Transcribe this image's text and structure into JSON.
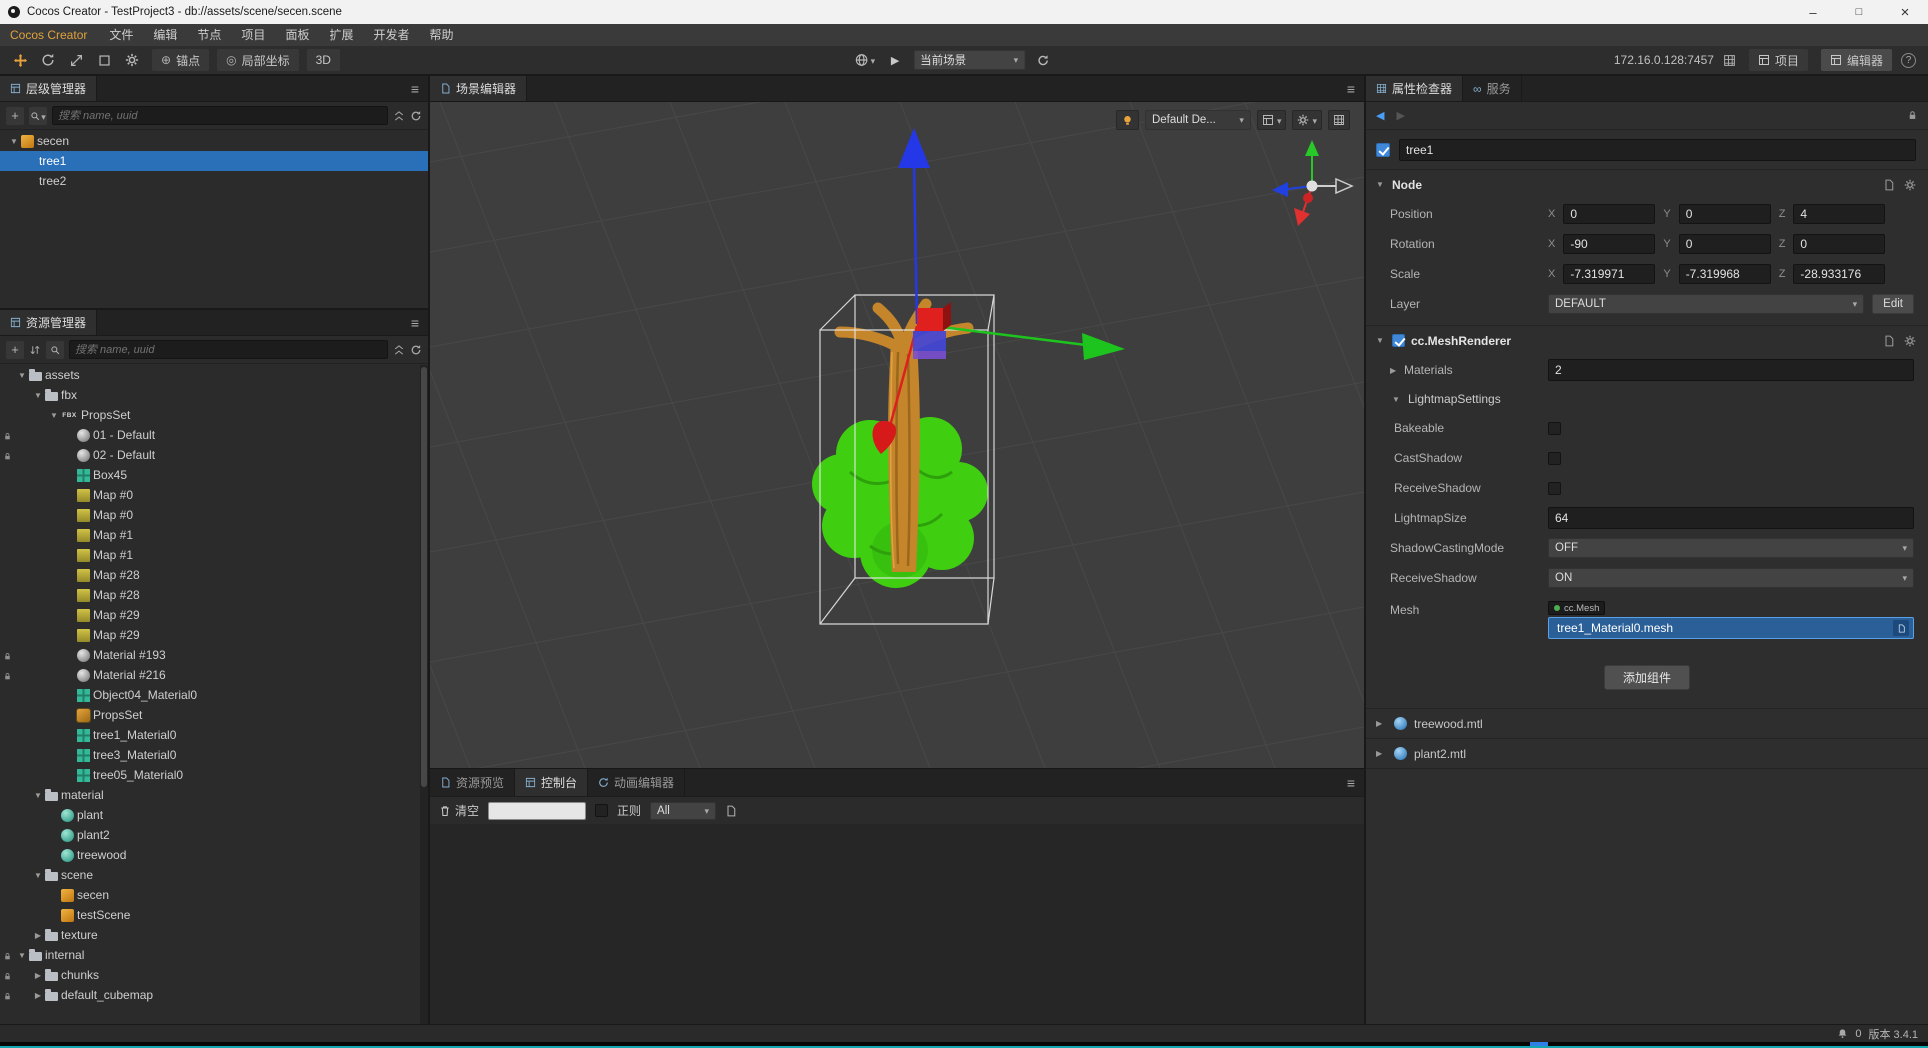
{
  "window": {
    "title": "Cocos Creator - TestProject3 - db://assets/scene/secen.scene"
  },
  "menubar": {
    "brand": "Cocos Creator",
    "items": [
      "文件",
      "编辑",
      "节点",
      "项目",
      "面板",
      "扩展",
      "开发者",
      "帮助"
    ]
  },
  "toolbar": {
    "anchor": "锚点",
    "local_coords": "局部坐标",
    "mode_3d": "3D",
    "scene_select": "当前场景",
    "address": "172.16.0.128:7457",
    "project": "项目",
    "editor": "编辑器"
  },
  "hierarchy": {
    "title": "层级管理器",
    "search_placeholder": "搜索 name, uuid",
    "nodes": [
      {
        "t": "secen",
        "d": 0,
        "i": "scene",
        "a": "open",
        "sel": 0
      },
      {
        "t": "tree1",
        "d": 1,
        "i": "none",
        "a": "none",
        "sel": 1
      },
      {
        "t": "tree2",
        "d": 1,
        "i": "none",
        "a": "none",
        "sel": 0
      }
    ]
  },
  "assets": {
    "title": "资源管理器",
    "search_placeholder": "搜索 name, uuid",
    "fbx_badge": "FBX",
    "items": [
      {
        "t": "assets",
        "i": "folder",
        "d": 0,
        "a": "open",
        "l": 0
      },
      {
        "t": "fbx",
        "i": "folder",
        "d": 1,
        "a": "open",
        "l": 0
      },
      {
        "t": "PropsSet",
        "i": "fbx",
        "d": 2,
        "a": "open",
        "l": 0
      },
      {
        "t": "01 - Default",
        "i": "matgray",
        "d": 3,
        "a": "none",
        "l": 1
      },
      {
        "t": "02 - Default",
        "i": "matgray",
        "d": 3,
        "a": "none",
        "l": 1
      },
      {
        "t": "Box45",
        "i": "mesh",
        "d": 3,
        "a": "none",
        "l": 0
      },
      {
        "t": "Map #0",
        "i": "image",
        "d": 3,
        "a": "none",
        "l": 0
      },
      {
        "t": "Map #0",
        "i": "image",
        "d": 3,
        "a": "none",
        "l": 0
      },
      {
        "t": "Map #1",
        "i": "image",
        "d": 3,
        "a": "none",
        "l": 0
      },
      {
        "t": "Map #1",
        "i": "image",
        "d": 3,
        "a": "none",
        "l": 0
      },
      {
        "t": "Map #28",
        "i": "image",
        "d": 3,
        "a": "none",
        "l": 0
      },
      {
        "t": "Map #28",
        "i": "image",
        "d": 3,
        "a": "none",
        "l": 0
      },
      {
        "t": "Map #29",
        "i": "image",
        "d": 3,
        "a": "none",
        "l": 0
      },
      {
        "t": "Map #29",
        "i": "image",
        "d": 3,
        "a": "none",
        "l": 0
      },
      {
        "t": "Material #193",
        "i": "matgray",
        "d": 3,
        "a": "none",
        "l": 1
      },
      {
        "t": "Material #216",
        "i": "matgray",
        "d": 3,
        "a": "none",
        "l": 1
      },
      {
        "t": "Object04_Material0",
        "i": "mesh",
        "d": 3,
        "a": "none",
        "l": 0
      },
      {
        "t": "PropsSet",
        "i": "prefab",
        "d": 3,
        "a": "none",
        "l": 0
      },
      {
        "t": "tree1_Material0",
        "i": "mesh",
        "d": 3,
        "a": "none",
        "l": 0
      },
      {
        "t": "tree3_Material0",
        "i": "mesh",
        "d": 3,
        "a": "none",
        "l": 0
      },
      {
        "t": "tree05_Material0",
        "i": "mesh",
        "d": 3,
        "a": "none",
        "l": 0
      },
      {
        "t": "material",
        "i": "folder",
        "d": 1,
        "a": "open",
        "l": 0
      },
      {
        "t": "plant",
        "i": "matball",
        "d": 2,
        "a": "none",
        "l": 0
      },
      {
        "t": "plant2",
        "i": "matball",
        "d": 2,
        "a": "none",
        "l": 0
      },
      {
        "t": "treewood",
        "i": "matball",
        "d": 2,
        "a": "none",
        "l": 0
      },
      {
        "t": "scene",
        "i": "folder",
        "d": 1,
        "a": "open",
        "l": 0
      },
      {
        "t": "secen",
        "i": "scene",
        "d": 2,
        "a": "none",
        "l": 0
      },
      {
        "t": "testScene",
        "i": "scene",
        "d": 2,
        "a": "none",
        "l": 0
      },
      {
        "t": "texture",
        "i": "folder",
        "d": 1,
        "a": "closed",
        "l": 0
      },
      {
        "t": "internal",
        "i": "folder",
        "d": 0,
        "a": "open",
        "l": 1
      },
      {
        "t": "chunks",
        "i": "folder",
        "d": 1,
        "a": "closed",
        "l": 1
      },
      {
        "t": "default_cubemap",
        "i": "folder",
        "d": 1,
        "a": "closed",
        "l": 1
      }
    ]
  },
  "scene": {
    "tab": "场景编辑器",
    "overlay": {
      "profile": "Default De..."
    }
  },
  "console": {
    "tabs": [
      "资源预览",
      "控制台",
      "动画编辑器"
    ],
    "clear": "清空",
    "regex": "正则",
    "filter": "All"
  },
  "inspector": {
    "tab_inspector": "属性检查器",
    "tab_service": "服务",
    "node_name": "tree1",
    "axis_labels": {
      "x": "X",
      "y": "Y",
      "z": "Z"
    },
    "node": {
      "title": "Node",
      "position": {
        "label": "Position",
        "x": "0",
        "y": "0",
        "z": "4"
      },
      "rotation": {
        "label": "Rotation",
        "x": "-90",
        "y": "0",
        "z": "0"
      },
      "scale": {
        "label": "Scale",
        "x": "-7.319971",
        "y": "-7.319968",
        "z": "-28.933176"
      },
      "layer": {
        "label": "Layer",
        "value": "DEFAULT",
        "edit": "Edit"
      }
    },
    "mesh_renderer": {
      "title": "cc.MeshRenderer",
      "materials": {
        "label": "Materials",
        "value": "2"
      },
      "lightmap": {
        "title": "LightmapSettings",
        "bakeable": "Bakeable",
        "cast_shadow": "CastShadow",
        "receive_shadow": "ReceiveShadow",
        "size_label": "LightmapSize",
        "size_value": "64"
      },
      "shadow_casting": {
        "label": "ShadowCastingMode",
        "value": "OFF"
      },
      "receive_shadow": {
        "label": "ReceiveShadow",
        "value": "ON"
      },
      "mesh": {
        "label": "Mesh",
        "type": "cc.Mesh",
        "value": "tree1_Material0.mesh"
      }
    },
    "add_component": "添加组件",
    "mtl_files": [
      {
        "name": "treewood.mtl"
      },
      {
        "name": "plant2.mtl"
      }
    ]
  },
  "statusbar": {
    "notifications": "0",
    "version": "版本 3.4.1"
  },
  "colors": {
    "selection_blue": "#2a70b9",
    "accent_orange": "#e8a33d",
    "mesh_field_blue": "#2a5f98",
    "gizmo_x_red": "#de1f1f",
    "gizmo_y_green": "#1ec41e",
    "gizmo_z_blue": "#2438e8",
    "taskbar_teal": "#13a7b0"
  }
}
